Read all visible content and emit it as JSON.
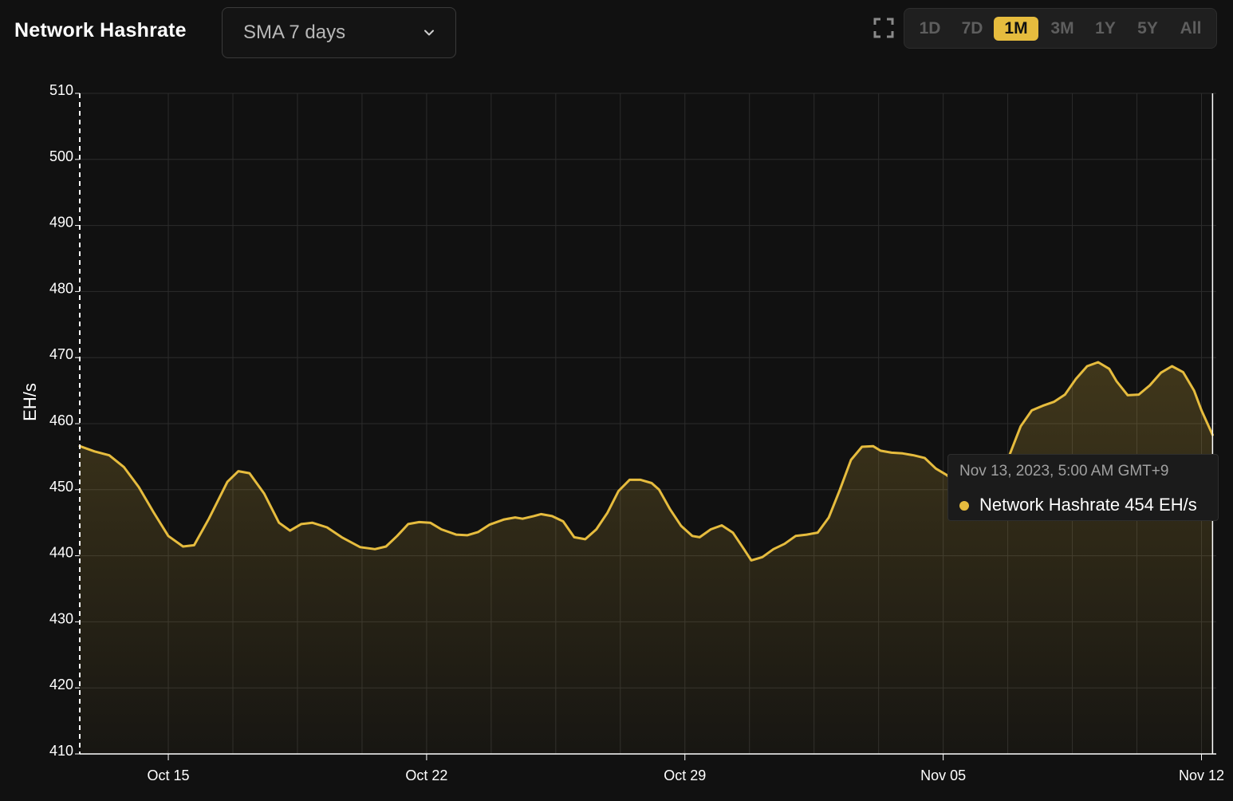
{
  "header": {
    "title": "Network Hashrate",
    "sma_select": "SMA 7 days",
    "fullscreen_icon": "fullscreen-icon",
    "ranges": [
      "1D",
      "7D",
      "1M",
      "3M",
      "1Y",
      "5Y",
      "All"
    ],
    "active_range": "1M"
  },
  "colors": {
    "background": "#111111",
    "line": "#e6bc3e",
    "grid": "#2c2c2c",
    "active_range": "#e6bc3e"
  },
  "tooltip": {
    "date": "Nov 13, 2023, 5:00 AM GMT+9",
    "series": "Network Hashrate",
    "value": "454 EH/s"
  },
  "chart_data": {
    "type": "area",
    "title": "Network Hashrate",
    "xlabel": "",
    "ylabel": "EH/s",
    "ylim": [
      410,
      510
    ],
    "yticks": [
      410,
      420,
      430,
      440,
      450,
      460,
      470,
      480,
      490,
      500,
      510
    ],
    "xlim": [
      12.6,
      43.4
    ],
    "xticks": [
      {
        "day": 15,
        "label": "Oct 15"
      },
      {
        "day": 22,
        "label": "Oct 22"
      },
      {
        "day": 29,
        "label": "Oct 29"
      },
      {
        "day": 36,
        "label": "Nov 05"
      },
      {
        "day": 43,
        "label": "Nov 12"
      }
    ],
    "grid": true,
    "crosshair_day": 43.3,
    "x_unit": "days from Oct 1, 2023",
    "series": [
      {
        "name": "Network Hashrate",
        "points": [
          [
            12.6,
            456.6
          ],
          [
            13.0,
            455.8
          ],
          [
            13.4,
            455.2
          ],
          [
            13.8,
            453.4
          ],
          [
            14.2,
            450.4
          ],
          [
            14.6,
            446.6
          ],
          [
            15.0,
            443.0
          ],
          [
            15.4,
            441.4
          ],
          [
            15.7,
            441.6
          ],
          [
            16.1,
            445.6
          ],
          [
            16.6,
            451.2
          ],
          [
            16.9,
            452.8
          ],
          [
            17.2,
            452.5
          ],
          [
            17.6,
            449.4
          ],
          [
            18.0,
            445.0
          ],
          [
            18.3,
            443.8
          ],
          [
            18.6,
            444.8
          ],
          [
            18.9,
            445.0
          ],
          [
            19.3,
            444.3
          ],
          [
            19.7,
            442.8
          ],
          [
            20.2,
            441.3
          ],
          [
            20.6,
            441.0
          ],
          [
            20.9,
            441.4
          ],
          [
            21.2,
            443.0
          ],
          [
            21.5,
            444.8
          ],
          [
            21.8,
            445.1
          ],
          [
            22.1,
            445.0
          ],
          [
            22.4,
            444.0
          ],
          [
            22.8,
            443.2
          ],
          [
            23.1,
            443.1
          ],
          [
            23.4,
            443.6
          ],
          [
            23.7,
            444.7
          ],
          [
            24.1,
            445.5
          ],
          [
            24.4,
            445.8
          ],
          [
            24.6,
            445.6
          ],
          [
            24.9,
            446.0
          ],
          [
            25.1,
            446.3
          ],
          [
            25.4,
            446.0
          ],
          [
            25.7,
            445.2
          ],
          [
            26.0,
            442.8
          ],
          [
            26.3,
            442.5
          ],
          [
            26.6,
            444.0
          ],
          [
            26.9,
            446.5
          ],
          [
            27.2,
            449.8
          ],
          [
            27.5,
            451.5
          ],
          [
            27.8,
            451.5
          ],
          [
            28.1,
            451.0
          ],
          [
            28.3,
            450.0
          ],
          [
            28.6,
            447.0
          ],
          [
            28.9,
            444.5
          ],
          [
            29.2,
            443.0
          ],
          [
            29.4,
            442.8
          ],
          [
            29.7,
            444.0
          ],
          [
            30.0,
            444.6
          ],
          [
            30.3,
            443.5
          ],
          [
            30.6,
            441.0
          ],
          [
            30.8,
            439.3
          ],
          [
            31.1,
            439.8
          ],
          [
            31.4,
            441.0
          ],
          [
            31.7,
            441.8
          ],
          [
            32.0,
            443.0
          ],
          [
            32.3,
            443.2
          ],
          [
            32.6,
            443.5
          ],
          [
            32.9,
            445.8
          ],
          [
            33.2,
            450.0
          ],
          [
            33.5,
            454.5
          ],
          [
            33.8,
            456.5
          ],
          [
            34.1,
            456.6
          ],
          [
            34.3,
            455.9
          ],
          [
            34.6,
            455.6
          ],
          [
            34.9,
            455.5
          ],
          [
            35.2,
            455.2
          ],
          [
            35.5,
            454.8
          ],
          [
            35.8,
            453.2
          ],
          [
            36.1,
            452.2
          ],
          [
            36.3,
            451.2
          ],
          [
            36.5,
            450.8
          ],
          [
            36.8,
            450.5
          ],
          [
            37.0,
            450.3
          ],
          [
            37.3,
            450.6
          ],
          [
            37.5,
            451.4
          ],
          [
            37.8,
            455.3
          ],
          [
            38.1,
            459.6
          ],
          [
            38.4,
            462.0
          ],
          [
            38.7,
            462.7
          ],
          [
            39.0,
            463.3
          ],
          [
            39.3,
            464.4
          ],
          [
            39.6,
            466.8
          ],
          [
            39.9,
            468.7
          ],
          [
            40.2,
            469.3
          ],
          [
            40.5,
            468.3
          ],
          [
            40.7,
            466.4
          ],
          [
            41.0,
            464.3
          ],
          [
            41.3,
            464.4
          ],
          [
            41.6,
            465.8
          ],
          [
            41.9,
            467.7
          ],
          [
            42.2,
            468.7
          ],
          [
            42.5,
            467.8
          ],
          [
            42.8,
            465.0
          ],
          [
            43.0,
            462.0
          ],
          [
            43.3,
            458.3
          ]
        ]
      }
    ]
  }
}
